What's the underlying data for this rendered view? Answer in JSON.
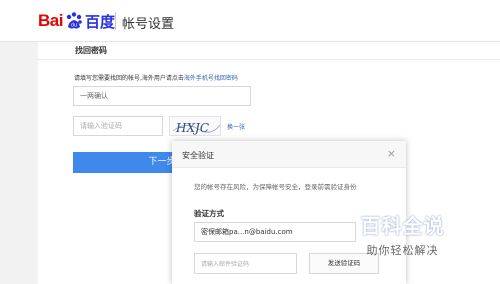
{
  "header": {
    "logo_prefix": "Bai",
    "logo_suffix": "百度",
    "title": "帐号设置"
  },
  "main": {
    "section_title": "找回密码",
    "tip": "请填写您需要找回的帐号,海外用户请点击",
    "tip_link": "海外手机号找回密码",
    "account_value": "一两确认",
    "captcha_placeholder": "请输入验证码",
    "captcha_image_text": "HXJC",
    "refresh_label": "换一张",
    "next_label": "下一步"
  },
  "modal": {
    "title": "安全验证",
    "close": "×",
    "description": "您的帐号存在风险，为保障帐号安全，登录前需验证身份",
    "method_label": "验证方式",
    "method_value": "密保邮箱pa...n@baidu.com",
    "code_placeholder": "请输入邮件验证码",
    "send_label": "发送验证码"
  },
  "watermark": {
    "main": "百科全说",
    "sub": "助你轻松解决"
  },
  "colors": {
    "brand_red": "#e10602",
    "brand_blue": "#2932e1",
    "primary_button": "#3f89ec",
    "link": "#2d64b3"
  }
}
